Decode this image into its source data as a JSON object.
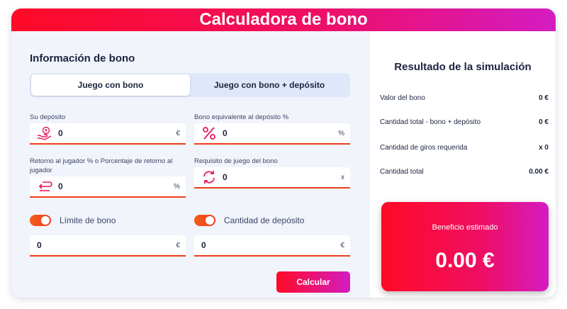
{
  "header": {
    "title": "Calculadora de bono"
  },
  "form": {
    "title": "Información de bono",
    "tabs": [
      {
        "label": "Juego con bono",
        "active": true
      },
      {
        "label": "Juego con bono + depósito",
        "active": false
      }
    ],
    "fields": {
      "deposit": {
        "label": "Su depósito",
        "value": "0",
        "unit": "€",
        "icon": "hand-coin-icon"
      },
      "bonus_percent": {
        "label": "Bono equivalente al depósito %",
        "value": "0",
        "unit": "%",
        "icon": "percent-icon"
      },
      "rtp": {
        "label": "Retorno al jugador % o Porcentaje de retorno al jugador",
        "value": "0",
        "unit": "%",
        "icon": "return-arrow-icon"
      },
      "wagering": {
        "label": "Requisito de juego del bono",
        "value": "0",
        "unit": "x",
        "icon": "refresh-icon"
      },
      "bonus_limit": {
        "value": "0",
        "unit": "€"
      },
      "deposit_amount": {
        "value": "0",
        "unit": "€"
      }
    },
    "toggles": {
      "bonus_limit": {
        "label": "Límite de bono",
        "on": true
      },
      "deposit_amount": {
        "label": "Cantidad de depósito",
        "on": true
      }
    },
    "calculate_label": "Calcular"
  },
  "results": {
    "title": "Resultado de la simulación",
    "rows": [
      {
        "label": "Valor del bono",
        "value": "0 €"
      },
      {
        "label": "Cantidad total - bono + depósito",
        "value": "0 €"
      },
      {
        "label": "Cantidad de giros requerida",
        "value": "x 0"
      },
      {
        "label": "Cantidad total",
        "value": "0.00 €"
      }
    ],
    "benefit": {
      "label": "Beneficio estimado",
      "value": "0.00 €"
    }
  },
  "colors": {
    "accent_start": "#ff0a26",
    "accent_end": "#d41cc2",
    "underline": "#ef3c1c"
  }
}
